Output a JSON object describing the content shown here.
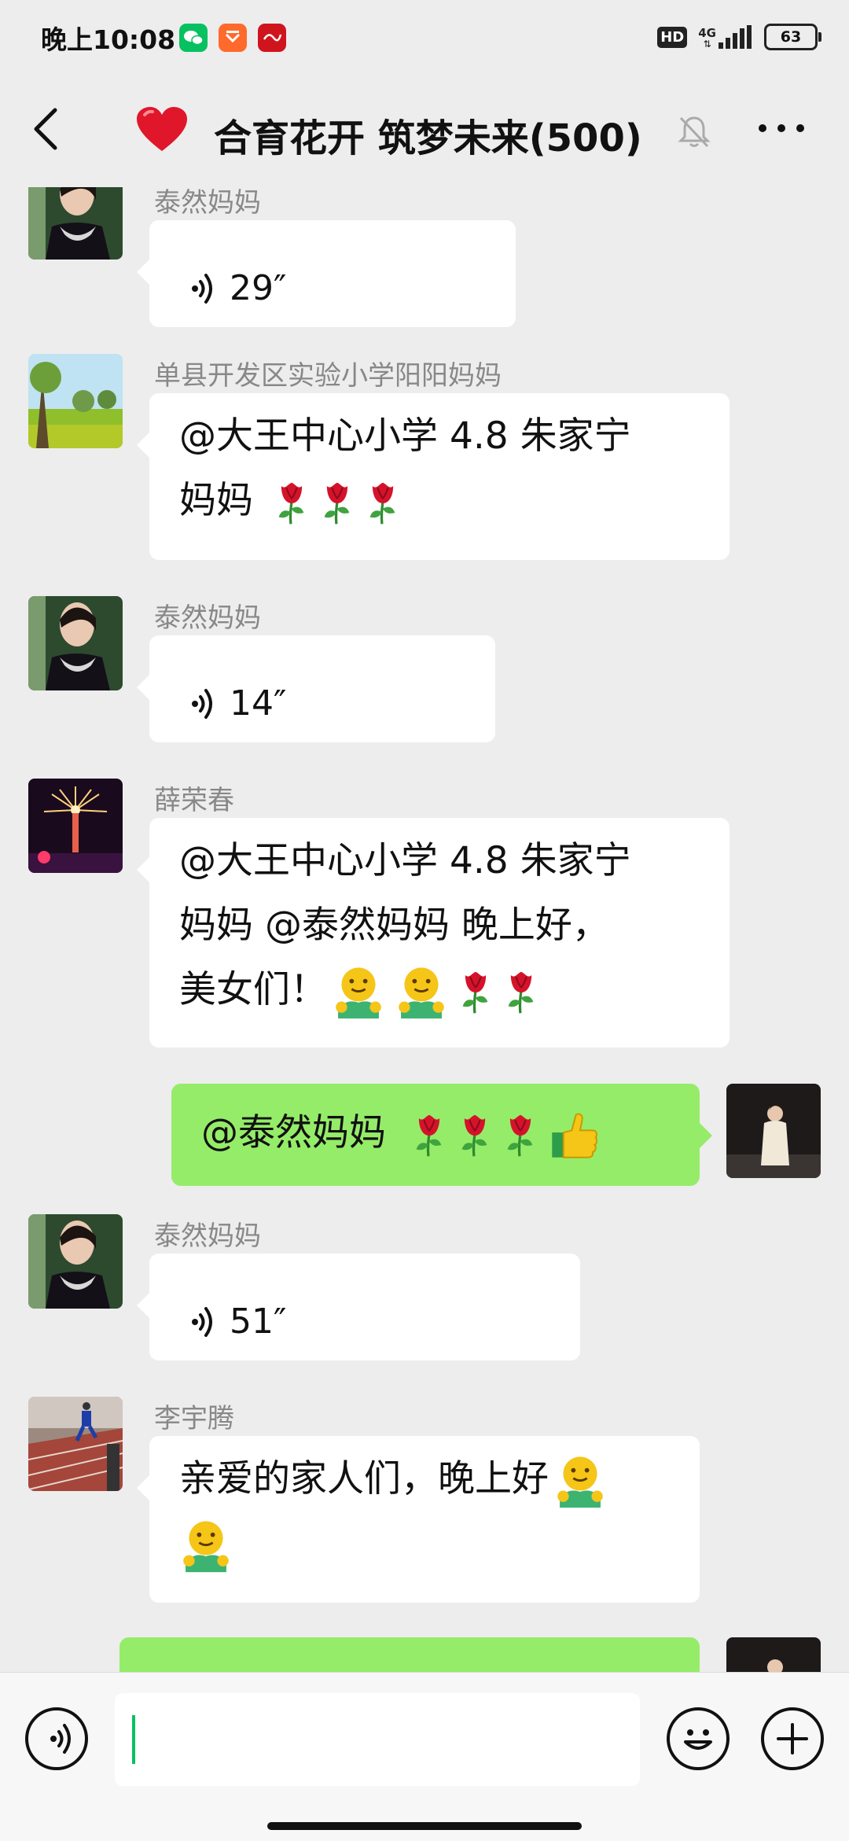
{
  "status_bar": {
    "time": "晚上10:08",
    "hd": "HD",
    "network": "4G",
    "battery": "63"
  },
  "header": {
    "title": "合育花开 筑梦未来(500)",
    "icons": [
      "back-icon",
      "heart-emoji",
      "mute-bell-icon",
      "more-icon"
    ]
  },
  "messages": [
    {
      "sender": "泰然妈妈",
      "type": "voice",
      "duration": "29″"
    },
    {
      "sender": "单县开发区实验小学阳阳妈妈",
      "type": "text",
      "line1": "@大王中心小学 4.8 朱家宁",
      "line2": "妈妈"
    },
    {
      "sender": "泰然妈妈",
      "type": "voice",
      "duration": "14″"
    },
    {
      "sender": "薛荣春",
      "type": "text",
      "line1": "@大王中心小学 4.8 朱家宁",
      "line2": "妈妈 @泰然妈妈  晚上好，",
      "line3": "美女们！"
    },
    {
      "sender": "",
      "type": "text",
      "outgoing": true,
      "line1": "@泰然妈妈"
    },
    {
      "sender": "泰然妈妈",
      "type": "voice",
      "duration": "51″"
    },
    {
      "sender": "李宇腾",
      "type": "text",
      "line1": "亲爱的家人们，晚上好"
    }
  ],
  "emoji": {
    "rose": "rose",
    "hug": "hugging-face",
    "thumb": "thumbs-up"
  },
  "input": {
    "value": ""
  },
  "colors": {
    "background": "#EDEDED",
    "outgoing_bubble": "#95EC69",
    "incoming_bubble": "#FFFFFF",
    "caret": "#07C160"
  }
}
